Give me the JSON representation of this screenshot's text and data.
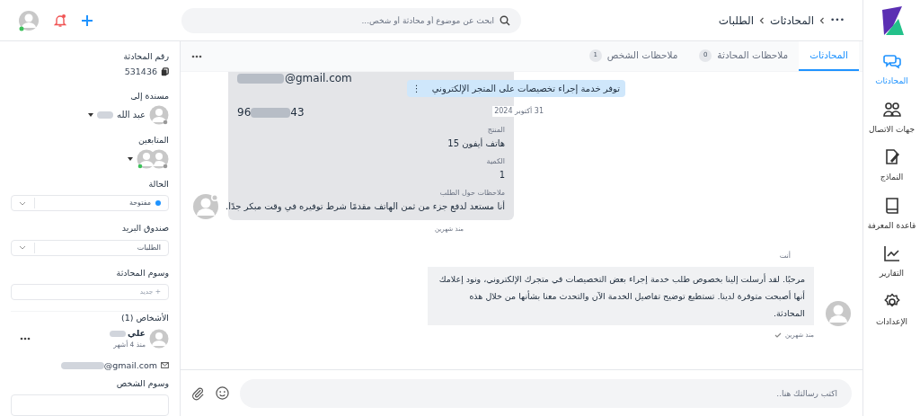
{
  "topbar": {
    "breadcrumb": [
      "•••",
      "المحادثات",
      "الطلبات"
    ],
    "search": {
      "placeholder": "ابحث عن موضوع أو محادثة أو شخص..."
    }
  },
  "nav": [
    {
      "label": "المحادثات",
      "selected": true
    },
    {
      "label": "جهات الاتصال",
      "selected": false
    },
    {
      "label": "النماذج",
      "selected": false
    },
    {
      "label": "قاعدة المعرفة",
      "selected": false
    },
    {
      "label": "التقارير",
      "selected": false
    },
    {
      "label": "الإعدادات",
      "selected": false
    }
  ],
  "tabs": [
    {
      "label": "المحادثات",
      "selected": true
    },
    {
      "label": "ملاحظات المحادثة",
      "count": "0",
      "selected": false
    },
    {
      "label": "ملاحظات الشخص",
      "count": "1",
      "selected": false
    }
  ],
  "banner": {
    "text": "توفر خدمة إجراء تخصيصات على المتجر الإلكتروني",
    "menu": "⋮",
    "date": "31 أكتوبر 2024"
  },
  "incoming": {
    "email": "@gmail.com",
    "phone_start": "96",
    "phone_end": "43",
    "fields": [
      {
        "label": "المنتج",
        "value": "هاتف أيفون 15"
      },
      {
        "label": "الكمية",
        "value": "1"
      },
      {
        "label": "ملاحظات حول الطلب",
        "value": "أنا مستعد لدفع جزء من ثمن الهاتف مقدمًا شرط توفيره في وقت مبكر جدًا."
      }
    ],
    "time": "منذ شهرين"
  },
  "outgoing": {
    "sender": "أنت",
    "text": "مرحبًا. لقد أرسلت إلينا بخصوص طلب خدمة إجراء بعض التخصيصات في متجرك الإلكتروني، ونود إعلامك أنها أصبحت متوفرة لدينا. تستطيع توضيح تفاصيل الخدمة الآن والتحدث معنا بشأنها من خلال هذه المحادثة.",
    "time": "منذ شهرين",
    "delivered": true
  },
  "composer": {
    "placeholder": "اكتب رسالتك هنا.."
  },
  "details": {
    "id_label": "رقم المحادثة",
    "id": "531436",
    "assignee_label": "مسندة إلى",
    "assignee": "عبد الله",
    "followers_label": "المتابعين",
    "status_label": "الحالة",
    "status": {
      "text": "مفتوحة",
      "color": "#1f93ff"
    },
    "inbox_label": "صندوق البريد",
    "inbox": "الطلبات",
    "tags_label": "وسوم المحادثة",
    "tags_placeholder": "+ جديد",
    "people_label": "الأشخاص (1)",
    "person": {
      "name": "علي",
      "time": "منذ 4 أشهر",
      "email": "@gmail.com"
    },
    "person_tags_label": "وسوم الشخص"
  }
}
